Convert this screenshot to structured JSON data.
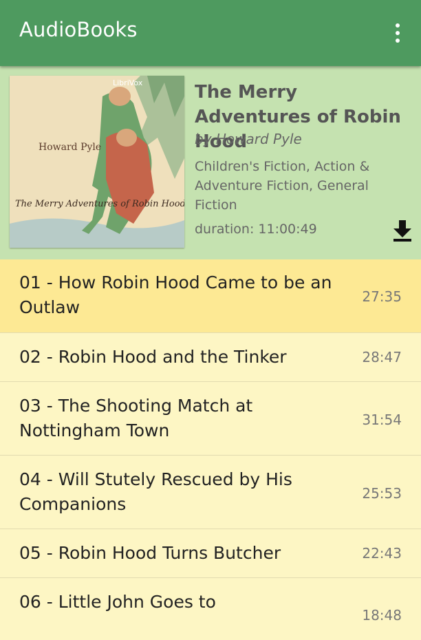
{
  "app": {
    "title": "AudioBooks"
  },
  "book": {
    "title": "The Merry Adventures of Robin Hood",
    "author": "by Howard Pyle",
    "genres": "Children's Fiction, Action & Adventure Fiction, General Fiction",
    "duration": "duration: 11:00:49",
    "cover": {
      "author_text": "Howard Pyle",
      "title_text": "The Merry Adventures of Robin Hood",
      "logo_text": "LibriVox"
    }
  },
  "chapters": [
    {
      "title": "01 - How Robin Hood Came to be an Outlaw",
      "duration": "27:35"
    },
    {
      "title": "02 - Robin Hood and the Tinker",
      "duration": "28:47"
    },
    {
      "title": "03 - The Shooting Match at Nottingham Town",
      "duration": "31:54"
    },
    {
      "title": "04 - Will Stutely Rescued by His Companions",
      "duration": "25:53"
    },
    {
      "title": "05 - Robin Hood Turns Butcher",
      "duration": "22:43"
    },
    {
      "title": "06 - Little John Goes to",
      "duration": "18:48"
    }
  ],
  "colors": {
    "appbar": "#4e9a5f",
    "header": "#c5e2b0",
    "active_row": "#fde994",
    "row": "#fdf6c4"
  }
}
